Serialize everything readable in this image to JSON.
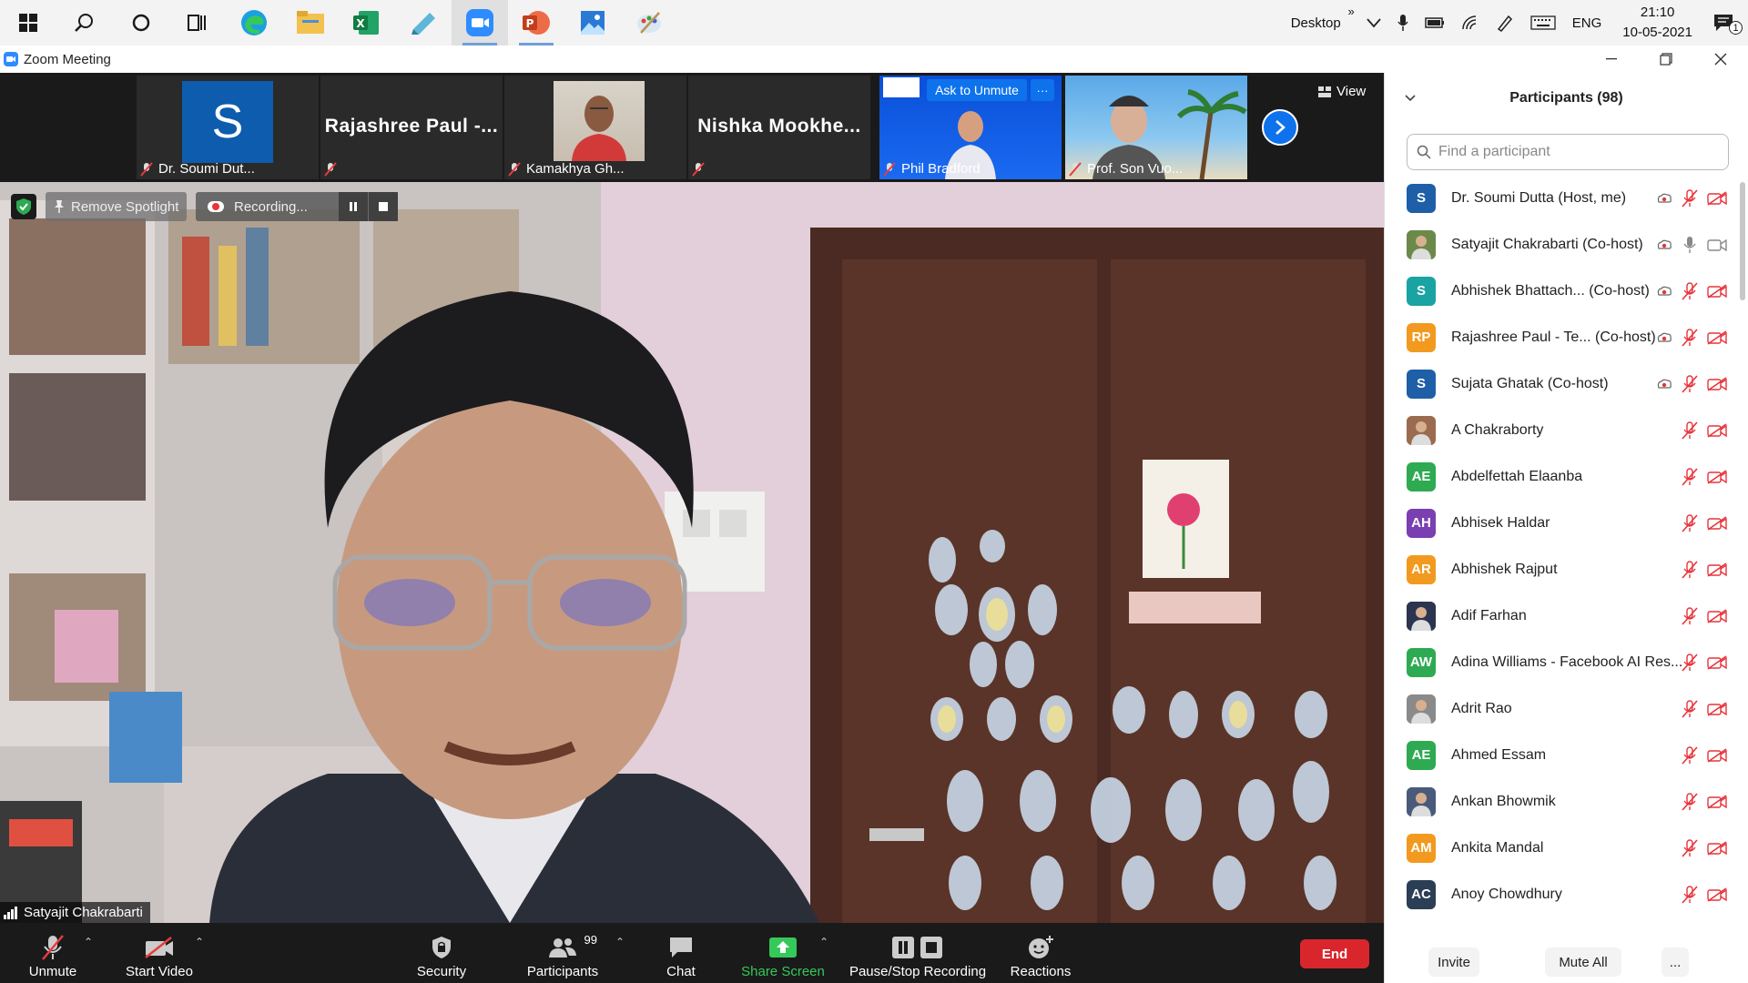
{
  "taskbar": {
    "desktop_label": "Desktop",
    "chevrons": "»",
    "lang": "ENG",
    "time": "21:10",
    "date": "10-05-2021",
    "notification_count": "1"
  },
  "window": {
    "title": "Zoom Meeting"
  },
  "strip": {
    "thumbs": [
      {
        "name": "Dr. Soumi Dut...",
        "avatar_letter": "S"
      },
      {
        "name": "Rajashree Paul -..."
      },
      {
        "name": "Kamakhya Gh..."
      },
      {
        "name": "Nishka Mookhe..."
      },
      {
        "name": "Phil Bradford",
        "ask_unmute": "Ask to Unmute",
        "more": "···"
      },
      {
        "name": "Prof. Son Vuo..."
      }
    ],
    "view_label": "View"
  },
  "main_video": {
    "remove_spotlight": "Remove Spotlight",
    "recording": "Recording...",
    "speaker_name": "Satyajit Chakrabarti"
  },
  "toolbar": {
    "unmute": "Unmute",
    "start_video": "Start Video",
    "security": "Security",
    "participants": "Participants",
    "participants_count": "99",
    "chat": "Chat",
    "share_screen": "Share Screen",
    "pause_stop": "Pause/Stop Recording",
    "reactions": "Reactions",
    "end": "End"
  },
  "panel": {
    "title": "Participants (98)",
    "search_placeholder": "Find a participant",
    "participants": [
      {
        "name": "Dr. Soumi Dutta (Host, me)",
        "initials": "S",
        "color": "#1e5fa8",
        "rec": true
      },
      {
        "name": "Satyajit Chakrabarti (Co-host)",
        "initials": "",
        "color": "#6b8a4a",
        "rec": true,
        "photo": true,
        "live": true
      },
      {
        "name": "Abhishek Bhattach...  (Co-host)",
        "initials": "S",
        "color": "#1aa3a3",
        "rec": true
      },
      {
        "name": "Rajashree Paul - Te...  (Co-host)",
        "initials": "RP",
        "color": "#f29a1f",
        "rec": true
      },
      {
        "name": "Sujata Ghatak  (Co-host)",
        "initials": "S",
        "color": "#1e5fa8",
        "rec": true
      },
      {
        "name": "A Chakraborty",
        "initials": "",
        "color": "#9a6b4f",
        "photo": true
      },
      {
        "name": "Abdelfettah Elaanba",
        "initials": "AE",
        "color": "#2eaa52"
      },
      {
        "name": "Abhisek Haldar",
        "initials": "AH",
        "color": "#7a3fb0"
      },
      {
        "name": "Abhishek Rajput",
        "initials": "AR",
        "color": "#f29a1f"
      },
      {
        "name": "Adif Farhan",
        "initials": "",
        "color": "#2b3550",
        "photo": true
      },
      {
        "name": "Adina Williams - Facebook AI Res...",
        "initials": "AW",
        "color": "#2eaa52"
      },
      {
        "name": "Adrit Rao",
        "initials": "",
        "color": "#8a8a8a",
        "photo": true
      },
      {
        "name": "Ahmed Essam",
        "initials": "AE",
        "color": "#2eaa52"
      },
      {
        "name": "Ankan Bhowmik",
        "initials": "",
        "color": "#4a5a7a",
        "photo": true
      },
      {
        "name": "Ankita Mandal",
        "initials": "AM",
        "color": "#f29a1f"
      },
      {
        "name": "Anoy Chowdhury",
        "initials": "AC",
        "color": "#2b3e55"
      }
    ],
    "invite": "Invite",
    "mute_all": "Mute All",
    "more": "..."
  }
}
